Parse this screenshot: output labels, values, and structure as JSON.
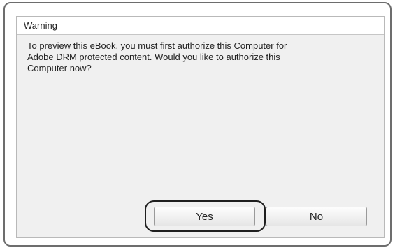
{
  "dialog": {
    "title": "Warning",
    "message": "To preview this eBook, you must first authorize this Computer for\nAdobe DRM protected content. Would you like to authorize this\nComputer now?",
    "buttons": {
      "yes_label": "Yes",
      "no_label": "No"
    }
  },
  "colors": {
    "frame_border": "#6d6d6d",
    "dialog_background": "#f0f0f0",
    "highlight_outline": "#1f1f1f"
  }
}
